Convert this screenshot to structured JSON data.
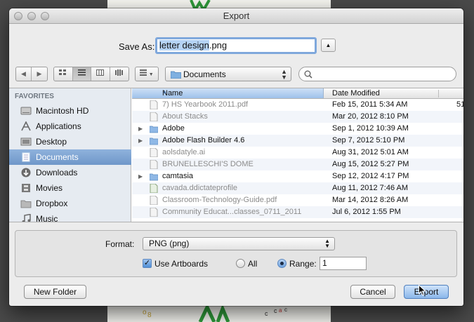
{
  "window": {
    "title": "Export"
  },
  "save_as": {
    "label": "Save As:",
    "value_selected": "letter design",
    "value_ext": ".png"
  },
  "toolbar": {
    "nav": [
      "◀",
      "▶"
    ],
    "views": [
      "icon-view",
      "list-view",
      "column-view",
      "coverflow-view"
    ],
    "arrange_icon": "arrange-icon",
    "location": "Documents",
    "search_placeholder": ""
  },
  "sidebar": {
    "heading": "FAVORITES",
    "items": [
      {
        "label": "Macintosh HD",
        "icon": "disk-icon",
        "selected": false
      },
      {
        "label": "Applications",
        "icon": "applications-icon",
        "selected": false
      },
      {
        "label": "Desktop",
        "icon": "desktop-icon",
        "selected": false
      },
      {
        "label": "Documents",
        "icon": "documents-icon",
        "selected": true
      },
      {
        "label": "Downloads",
        "icon": "downloads-icon",
        "selected": false
      },
      {
        "label": "Movies",
        "icon": "movies-icon",
        "selected": false
      },
      {
        "label": "Dropbox",
        "icon": "folder-icon",
        "selected": false
      },
      {
        "label": "Music",
        "icon": "music-icon",
        "selected": false
      }
    ]
  },
  "files": {
    "columns": {
      "name": "Name",
      "date": "Date Modified"
    },
    "rows": [
      {
        "name": "7) HS Yearbook 2011.pdf",
        "date": "Feb 15, 2011 5:34 AM",
        "extra": "51",
        "type": "file",
        "dim": true
      },
      {
        "name": "About Stacks",
        "date": "Mar 20, 2012 8:10 PM",
        "extra": "",
        "type": "file",
        "dim": true
      },
      {
        "name": "Adobe",
        "date": "Sep 1, 2012 10:39 AM",
        "extra": "",
        "type": "folder",
        "dim": false
      },
      {
        "name": "Adobe Flash Builder 4.6",
        "date": "Sep 7, 2012 5:10 PM",
        "extra": "",
        "type": "folder",
        "dim": false
      },
      {
        "name": "aolsdatyle.ai",
        "date": "Aug 31, 2012 5:01 AM",
        "extra": "",
        "type": "file",
        "dim": true
      },
      {
        "name": "BRUNELLESCHI'S DOME",
        "date": "Aug 15, 2012 5:27 PM",
        "extra": "",
        "type": "file",
        "dim": true
      },
      {
        "name": "camtasia",
        "date": "Sep 12, 2012 4:17 PM",
        "extra": "",
        "type": "folder",
        "dim": false
      },
      {
        "name": "cavada.ddictateprofile",
        "date": "Aug 11, 2012 7:46 AM",
        "extra": "",
        "type": "file",
        "dim": true
      },
      {
        "name": "Classroom-Technology-Guide.pdf",
        "date": "Mar 14, 2012 8:26 AM",
        "extra": "",
        "type": "file",
        "dim": true
      },
      {
        "name": "Community Educat...classes_0711_2011",
        "date": "Jul 6, 2012 1:55 PM",
        "extra": "",
        "type": "file",
        "dim": true
      }
    ]
  },
  "options": {
    "format_label": "Format:",
    "format_value": "PNG (png)",
    "use_artboards_label": "Use Artboards",
    "use_artboards_checked": true,
    "all_label": "All",
    "range_label": "Range:",
    "range_value": "1"
  },
  "buttons": {
    "new_folder": "New Folder",
    "cancel": "Cancel",
    "export": "Export"
  }
}
